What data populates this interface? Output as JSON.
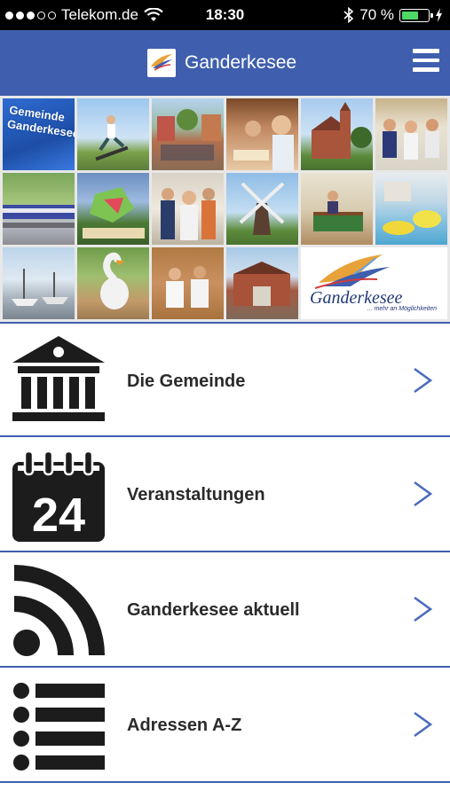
{
  "status_bar": {
    "carrier": "Telekom.de",
    "time": "18:30",
    "battery_percent_text": "70 %",
    "battery_level": 0.7,
    "signal_bars_filled": 3,
    "signal_bars_total": 5
  },
  "header": {
    "title": "Ganderkesee",
    "menu_icon": "hamburger-menu-icon"
  },
  "collage": {
    "sign_text": "Gemeinde Ganderkesee",
    "logo_text": "Ganderkesee",
    "logo_tagline": "... mehr an Möglichkeiten"
  },
  "menu": [
    {
      "label": "Die Gemeinde",
      "icon": "town-hall-icon"
    },
    {
      "label": "Veranstaltungen",
      "icon": "calendar-24-icon",
      "icon_text": "24"
    },
    {
      "label": "Ganderkesee aktuell",
      "icon": "rss-feed-icon"
    },
    {
      "label": "Adressen A-Z",
      "icon": "list-icon"
    }
  ],
  "colors": {
    "brand_blue": "#3f5fae",
    "chevron": "#4a6bbd",
    "icon_dark": "#1c1c1c",
    "battery_green": "#4cd964"
  }
}
